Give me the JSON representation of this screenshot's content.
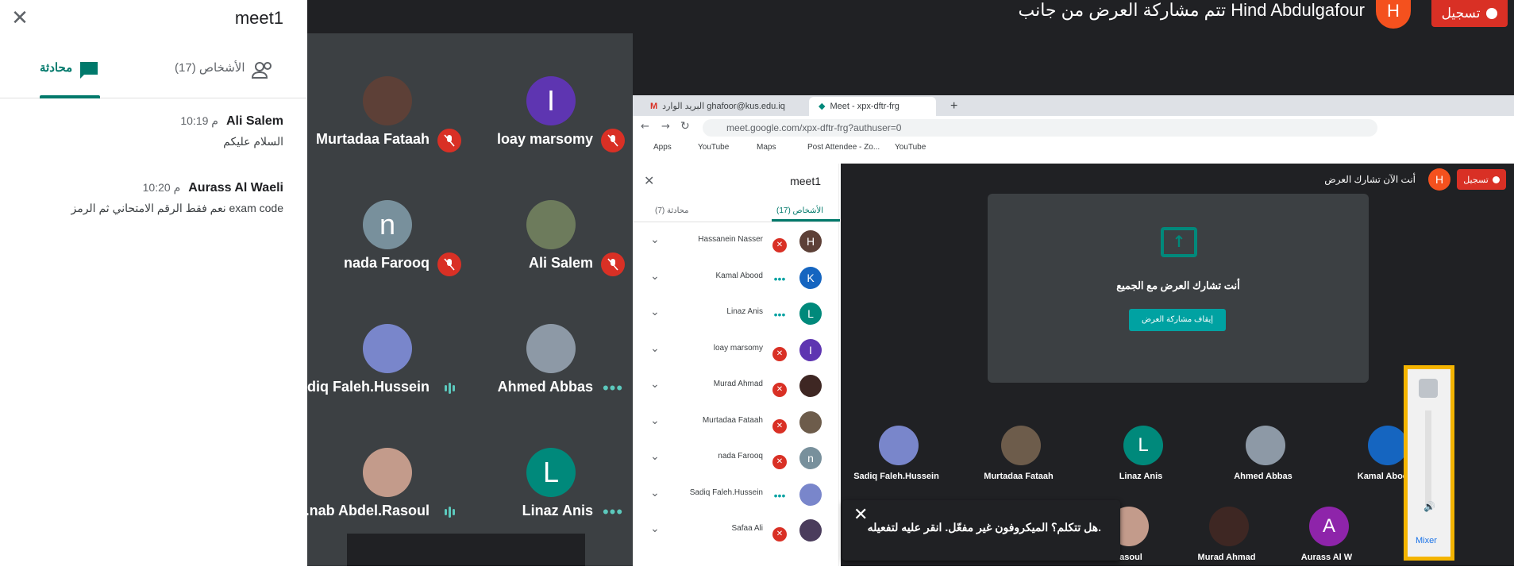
{
  "chat_panel": {
    "title": "meet1",
    "tab_people": "الأشخاص (17)",
    "tab_chat": "محادثة",
    "messages": [
      {
        "sender": "Ali Salem",
        "time": "10:19 م",
        "text": "السلام عليكم"
      },
      {
        "sender": "Aurass Al Waeli",
        "time": "10:20 م",
        "text": "نعم فقط الرقم الامتحاني ثم الرمز exam code"
      }
    ]
  },
  "topbar": {
    "presenting_text": "تتم مشاركة العرض من جانب Hind Abdulgafour",
    "presenter_initial": "H",
    "record_label": "تسجيل"
  },
  "grid": {
    "tiles": [
      {
        "name": "Murtadaa Fataah",
        "avatar": "",
        "color": "#5d4037",
        "status": "muted"
      },
      {
        "name": "loay marsomy",
        "avatar": "I",
        "color": "#5e35b1",
        "status": "muted"
      },
      {
        "name": "nada Farooq",
        "avatar": "n",
        "color": "#78909c",
        "status": "muted"
      },
      {
        "name": "Ali Salem",
        "avatar": "",
        "color": "#6d7b5c",
        "status": "muted"
      },
      {
        "name": "...diq Faleh.Hussein",
        "avatar": "",
        "color": "#7986cb",
        "status": "talking"
      },
      {
        "name": "Ahmed Abbas",
        "avatar": "",
        "color": "#8d99a6",
        "status": "dots"
      },
      {
        "name": "...nab Abdel.Rasoul",
        "avatar": "",
        "color": "#c39b8b",
        "status": "talking"
      },
      {
        "name": "Linaz Anis",
        "avatar": "L",
        "color": "#00897b",
        "status": "dots"
      }
    ]
  },
  "browser": {
    "tab1": "البريد الوارد ghafoor@kus.edu.iq",
    "tab2": "Meet - xpx-dftr-frg",
    "url": "meet.google.com/xpx-dftr-frg?authuser=0",
    "bookmarks": [
      "Apps",
      "YouTube",
      "Maps",
      "Post Attendee - Zo...",
      "YouTube"
    ]
  },
  "inner_people": {
    "title": "meet1",
    "tab_people": "الأشخاص (17)",
    "tab_chat": "محادثة (7)",
    "rows": [
      {
        "name": "Hassanein Nasser",
        "initial": "H",
        "color": "#5d4037",
        "status": "muted"
      },
      {
        "name": "Kamal Abood",
        "initial": "K",
        "color": "#1565c0",
        "status": "talking"
      },
      {
        "name": "Linaz Anis",
        "initial": "L",
        "color": "#00897b",
        "status": "talking"
      },
      {
        "name": "loay marsomy",
        "initial": "I",
        "color": "#5e35b1",
        "status": "muted"
      },
      {
        "name": "Murad Ahmad",
        "initial": "",
        "color": "#3e2723",
        "status": "muted"
      },
      {
        "name": "Murtadaa Fataah",
        "initial": "",
        "color": "#6d5c4b",
        "status": "muted"
      },
      {
        "name": "nada Farooq",
        "initial": "n",
        "color": "#78909c",
        "status": "muted"
      },
      {
        "name": "Sadiq Faleh.Hussein",
        "initial": "",
        "color": "#7986cb",
        "status": "talking"
      },
      {
        "name": "Safaa Ali",
        "initial": "",
        "color": "#4a3c5c",
        "status": "muted"
      }
    ]
  },
  "inner_stage": {
    "presenting_text": "أنت الآن تشارك العرض",
    "avatar_initial": "H",
    "record_label": "تسجيل",
    "card_text": "أنت تشارك العرض مع الجميع",
    "stop_button": "إيقاف مشاركة العرض",
    "strip_row1": [
      {
        "name": "Sadiq Faleh.Hussein",
        "initial": "",
        "color": "#7986cb"
      },
      {
        "name": "Murtadaa Fataah",
        "initial": "",
        "color": "#6d5c4b"
      },
      {
        "name": "Linaz Anis",
        "initial": "L",
        "color": "#00897b"
      },
      {
        "name": "Ahmed Abbas",
        "initial": "",
        "color": "#8d99a6"
      },
      {
        "name": "Kamal Abood",
        "initial": "",
        "color": "#1565c0"
      }
    ],
    "strip_row2": [
      {
        "name": ".Rasoul",
        "initial": "",
        "color": "#c39b8b"
      },
      {
        "name": "Murad Ahmad",
        "initial": "",
        "color": "#3e2723"
      },
      {
        "name": "Aurass Al W",
        "initial": "A",
        "color": "#8e24aa"
      }
    ]
  },
  "toast": {
    "text": "هل تتكلم؟ الميكروفون غير مفعّل. انقر عليه لتفعيله."
  },
  "volume": {
    "mixer_label": "Mixer"
  }
}
